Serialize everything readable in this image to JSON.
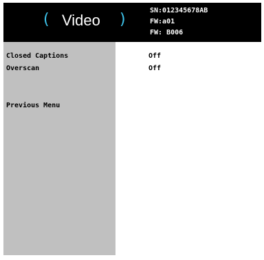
{
  "header": {
    "left_paren": "(",
    "title": "Video",
    "right_paren": ")",
    "serial": "SN:012345678AB",
    "firmware": "FW:a01",
    "firmware2": "FW: B006"
  },
  "menu": {
    "items": [
      {
        "label": "Closed Captions",
        "value": "Off"
      },
      {
        "label": "Overscan",
        "value": "Off"
      }
    ],
    "previous_menu": "Previous Menu"
  },
  "colors": {
    "header_bg": "#000000",
    "accent": "#3ec6ee",
    "sidebar_bg": "#c0c0c0",
    "content_bg": "#ffffff"
  }
}
